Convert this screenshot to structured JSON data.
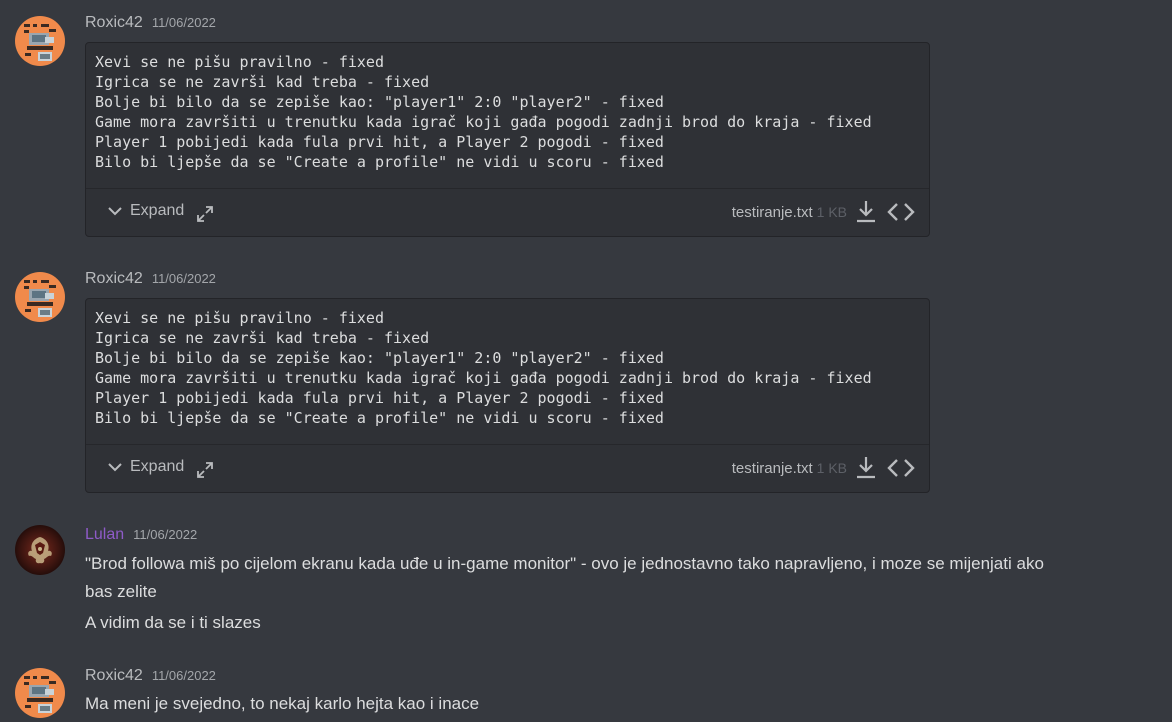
{
  "messages": [
    {
      "username": "Roxic42",
      "timestamp": "11/06/2022",
      "attachment": {
        "lines": [
          "Xevi se ne pišu pravilno - fixed",
          "Igrica se ne završi kad treba - fixed",
          "Bolje bi bilo da se zepiše kao: \"player1\" 2:0 \"player2\" - fixed",
          "Game mora završiti u trenutku kada igrač koji gađa pogodi zadnji brod do kraja - fixed",
          "Player 1 pobijedi kada fula prvi hit, a Player 2 pogodi - fixed",
          "Bilo bi ljepše da se \"Create a profile\" ne vidi u scoru - fixed"
        ],
        "expand_label": "Expand",
        "filename": "testiranje.txt",
        "filesize": "1 KB"
      }
    },
    {
      "username": "Roxic42",
      "timestamp": "11/06/2022",
      "attachment": {
        "lines": [
          "Xevi se ne pišu pravilno - fixed",
          "Igrica se ne završi kad treba - fixed",
          "Bolje bi bilo da se zepiše kao: \"player1\" 2:0 \"player2\" - fixed",
          "Game mora završiti u trenutku kada igrač koji gađa pogodi zadnji brod do kraja - fixed",
          "Player 1 pobijedi kada fula prvi hit, a Player 2 pogodi - fixed",
          "Bilo bi ljepše da se \"Create a profile\" ne vidi u scoru - fixed"
        ],
        "expand_label": "Expand",
        "filename": "testiranje.txt",
        "filesize": "1 KB"
      }
    },
    {
      "username": "Lulan",
      "timestamp": "11/06/2022",
      "username_color": "#8e5bc8",
      "lines": [
        "\"Brod followa miš po cijelom ekranu kada uđe u in-game monitor\" - ovo je jednostavno tako napravljeno, i moze se mijenjati ako",
        "bas zelite",
        "A vidim da se i ti slazes"
      ]
    },
    {
      "username": "Roxic42",
      "timestamp": "11/06/2022",
      "lines": [
        "Ma meni je svejedno, to nekaj karlo hejta kao i inace"
      ]
    }
  ],
  "colors": {
    "background": "#36393f",
    "attachment_bg": "#2f3136",
    "text": "#dcddde",
    "muted": "#b9bbbe",
    "lulan_name": "#8e5bc8",
    "roxic_avatar": "#f08a4b"
  },
  "icons": {
    "expand": "chevron-down-icon",
    "fullscreen": "fullscreen-icon",
    "download": "download-icon",
    "code": "code-icon",
    "avatar_roxic": "pixel-art-avatar",
    "avatar_lulan": "dragon-sigil-avatar"
  }
}
